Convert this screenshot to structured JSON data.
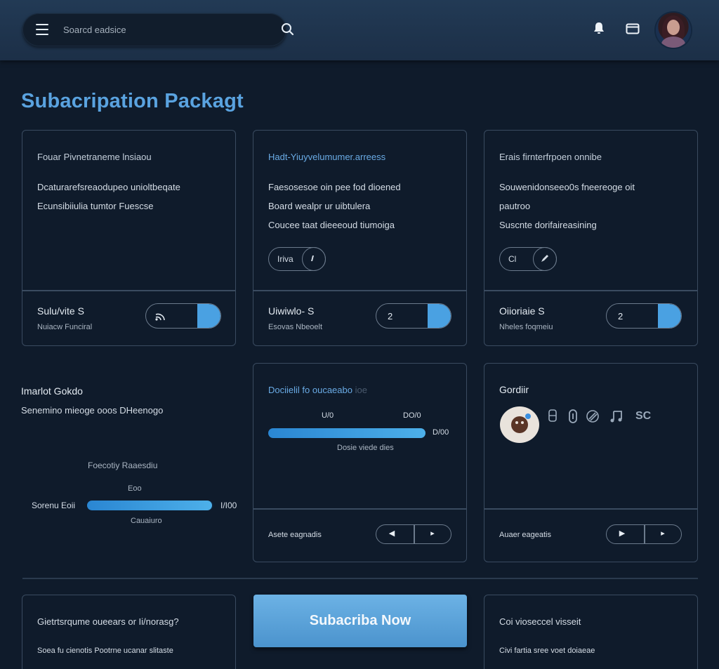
{
  "header": {
    "search_placeholder": "Soarcd eadsice",
    "icons": [
      "menu-icon",
      "search-icon",
      "bell-icon",
      "window-icon",
      "avatar"
    ]
  },
  "page_title": "Subacripation Packagt",
  "plans": [
    {
      "title": "Fouar Pivnetraneme lnsiaou",
      "lines": [
        "Dcaturarefsreaodupeo unioltbeqate",
        "Ecunsibiiulia tumtor Fuescse"
      ],
      "pill": null,
      "name": "Sulu/vite S",
      "sub": "Nuiacw Funciral",
      "qty": "",
      "stepper_icon": "wifi-icon"
    },
    {
      "title": "Hadt-Yiuyvelumumer.arreess",
      "lines": [
        "Faesosesoe oin pee fod dioened",
        "Board wealpr ur uibtulera",
        "Coucee taat dieeeoud tiumoiga"
      ],
      "pill": "Iriva",
      "name": "Uiwiwlo- S",
      "sub": "Esovas Nbeoelt",
      "qty": "2"
    },
    {
      "title": "Erais firnterfrpoen onnibe",
      "lines": [
        "Souwenidonseeo0s fneereoge oit",
        "pautroo",
        "Suscnte dorifaireasining"
      ],
      "pill": "Cl",
      "name": "Oiioriaie S",
      "sub": "Nheles foqmeiu",
      "qty": "2"
    }
  ],
  "market": {
    "title": "Imarlot Gokdo",
    "subtitle": "Senemino mieoge ooos DHeenogo",
    "bar_title": "Foecotiy Raaesdiu",
    "bar_top": "Eoo",
    "bar_left": "Sorenu Eoii",
    "bar_right": "I/I00",
    "bar_bottom": "Cauaiuro",
    "progress": 0.99
  },
  "progress_card": {
    "title": "Dociielil fo oucaeabo",
    "title_faded": "ioe",
    "left_value": "U/0",
    "right_value": "DO/0",
    "end_value": "D/00",
    "caption": "Dosie viede dies",
    "progress": 1.0,
    "footer_label": "Asete eagnadis"
  },
  "social_card": {
    "title": "Gordiir",
    "icons": [
      "figma-icon",
      "link-icon",
      "share-icon",
      "music-icon",
      "sc-icon"
    ],
    "sc_label": "SC",
    "footer_label": "Auaer eageatis"
  },
  "bottom": {
    "left_title": "Gietrtsrqume oueears or Ii/norasg?",
    "left_body": "Soea fu cienotis Pootrne ucanar slitaste",
    "cta": "Subacriba Now",
    "right_title": "Coi vioseccel visseit",
    "right_body": "Civi fartia sree voet doiaeae"
  }
}
